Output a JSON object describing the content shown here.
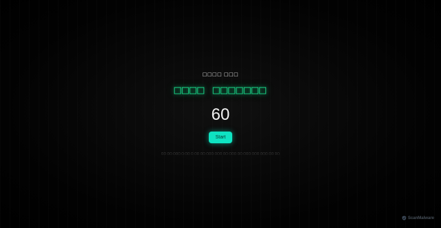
{
  "header": {
    "subtitle": "□□□□ □□□",
    "title": "□□□□ □□□□□□□"
  },
  "timer": {
    "value": "60"
  },
  "controls": {
    "start_label": "Start"
  },
  "hint": {
    "text": "□□ □□ □□□ □ □□ □ □□ □□ □□□ □□□ □□ □□□ □□ □□□ □□□ □□□ □□ □□"
  },
  "watermark": {
    "text": "ScanMalware",
    "icon": "scanmalware-logo-icon"
  },
  "colors": {
    "accent": "#19d98a",
    "button": "#0fe3c2",
    "background": "#000000"
  }
}
